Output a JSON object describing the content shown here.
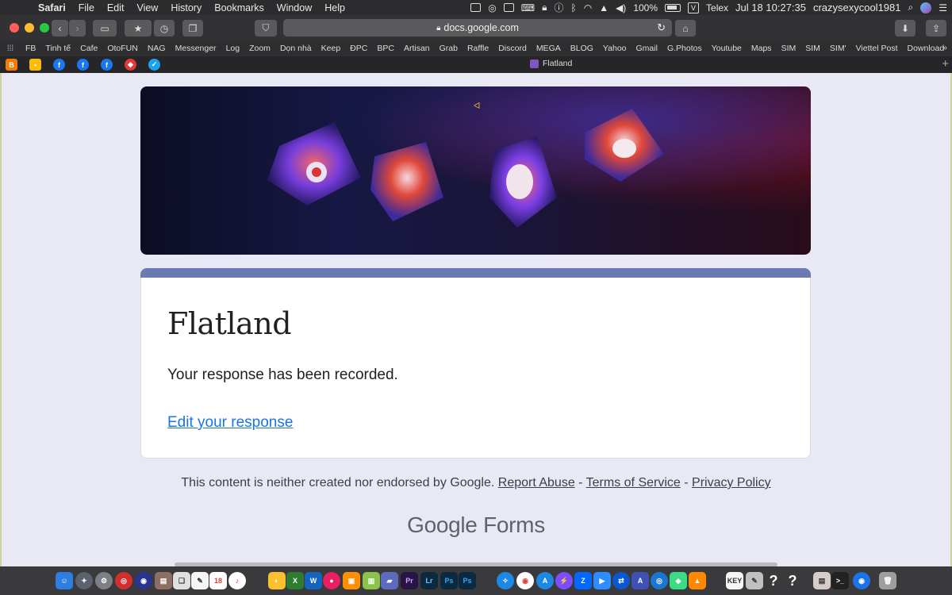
{
  "menubar": {
    "app": "Safari",
    "items": [
      "File",
      "Edit",
      "View",
      "History",
      "Bookmarks",
      "Window",
      "Help"
    ],
    "battery": "100%",
    "input_method": "Telex",
    "input_badge": "V",
    "clock": "Jul 18  10:27:35",
    "user": "crazysexycool1981"
  },
  "toolbar": {
    "url": "docs.google.com"
  },
  "bookmarks": [
    "FB",
    "Tinh tế",
    "Cafe",
    "OtoFUN",
    "NAG",
    "Messenger",
    "Log",
    "Zoom",
    "Dọn nhà",
    "Keep",
    "ĐPC",
    "BPC",
    "Artisan",
    "Grab",
    "Raffle",
    "Discord",
    "MEGA",
    "BLOG",
    "Yahoo",
    "Gmail",
    "G.Photos",
    "Youtube",
    "Maps",
    "SIM",
    "SIM",
    "SIM'",
    "Viettel Post",
    "Download"
  ],
  "tab": {
    "title": "Flatland"
  },
  "form": {
    "title": "Flatland",
    "message": "Your response has been recorded.",
    "edit_link": "Edit your response"
  },
  "footer": {
    "disclaimer": "This content is neither created nor endorsed by Google.",
    "report_abuse": "Report Abuse",
    "terms": "Terms of Service",
    "privacy": "Privacy Policy",
    "sep": " - ",
    "brand_google": "Google",
    "brand_forms": "Forms"
  },
  "dock": {
    "calendar_day": "18",
    "key_label": "KEY"
  },
  "colors": {
    "form_accent": "#6a7bb4",
    "link": "#1a73e8",
    "page_bg": "#e8e9f4"
  }
}
